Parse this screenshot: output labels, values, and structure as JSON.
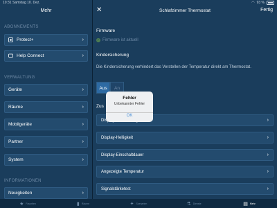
{
  "status": {
    "time": "10:31",
    "date": "Samstag 10. Dez.",
    "battery": "93 %"
  },
  "sidebar": {
    "title": "Mehr",
    "sections": [
      {
        "header": "ABONNEMENTS",
        "items": [
          {
            "label": "Protect+"
          },
          {
            "label": "Help Connect"
          }
        ]
      },
      {
        "header": "VERWALTUNG",
        "items": [
          {
            "label": "Geräte"
          },
          {
            "label": "Räume"
          },
          {
            "label": "Mobilgeräte"
          },
          {
            "label": "Partner"
          },
          {
            "label": "System"
          }
        ]
      },
      {
        "header": "INFORMATIONEN",
        "items": [
          {
            "label": "Neuigkeiten"
          }
        ]
      }
    ]
  },
  "main": {
    "close_glyph": "✕",
    "title": "Schlafzimmer Thermostat",
    "done": "Fertig",
    "firmware": {
      "title": "Firmware",
      "status": "Firmware ist aktuell"
    },
    "childlock": {
      "title": "Kindersicherung",
      "description": "Die Kindersicherung verhindert das Verstellen der Temperatur direkt am Thermostat.",
      "on": "Aus",
      "off": "An"
    },
    "section2": "Zus",
    "rows": [
      {
        "label": "Display-Ausrichtung"
      },
      {
        "label": "Display-Helligkeit"
      },
      {
        "label": "Display-Einschaltdauer"
      },
      {
        "label": "Angezeigte Temperatur"
      },
      {
        "label": "Signalstärketest"
      }
    ]
  },
  "alert": {
    "title": "Fehler",
    "message": "Unbekannter Fehler",
    "button": "OK"
  },
  "tabbar": [
    {
      "label": "Favoriten",
      "icon": "star-icon",
      "glyph": "★"
    },
    {
      "label": "Räume",
      "icon": "door-icon",
      "glyph": "▮"
    },
    {
      "label": "Szenarien",
      "icon": "wand-icon",
      "glyph": "✦"
    },
    {
      "label": "Dienste",
      "icon": "flask-icon",
      "glyph": "⚗"
    },
    {
      "label": "Mehr",
      "icon": "more-icon",
      "glyph": "▤",
      "active": true
    }
  ]
}
